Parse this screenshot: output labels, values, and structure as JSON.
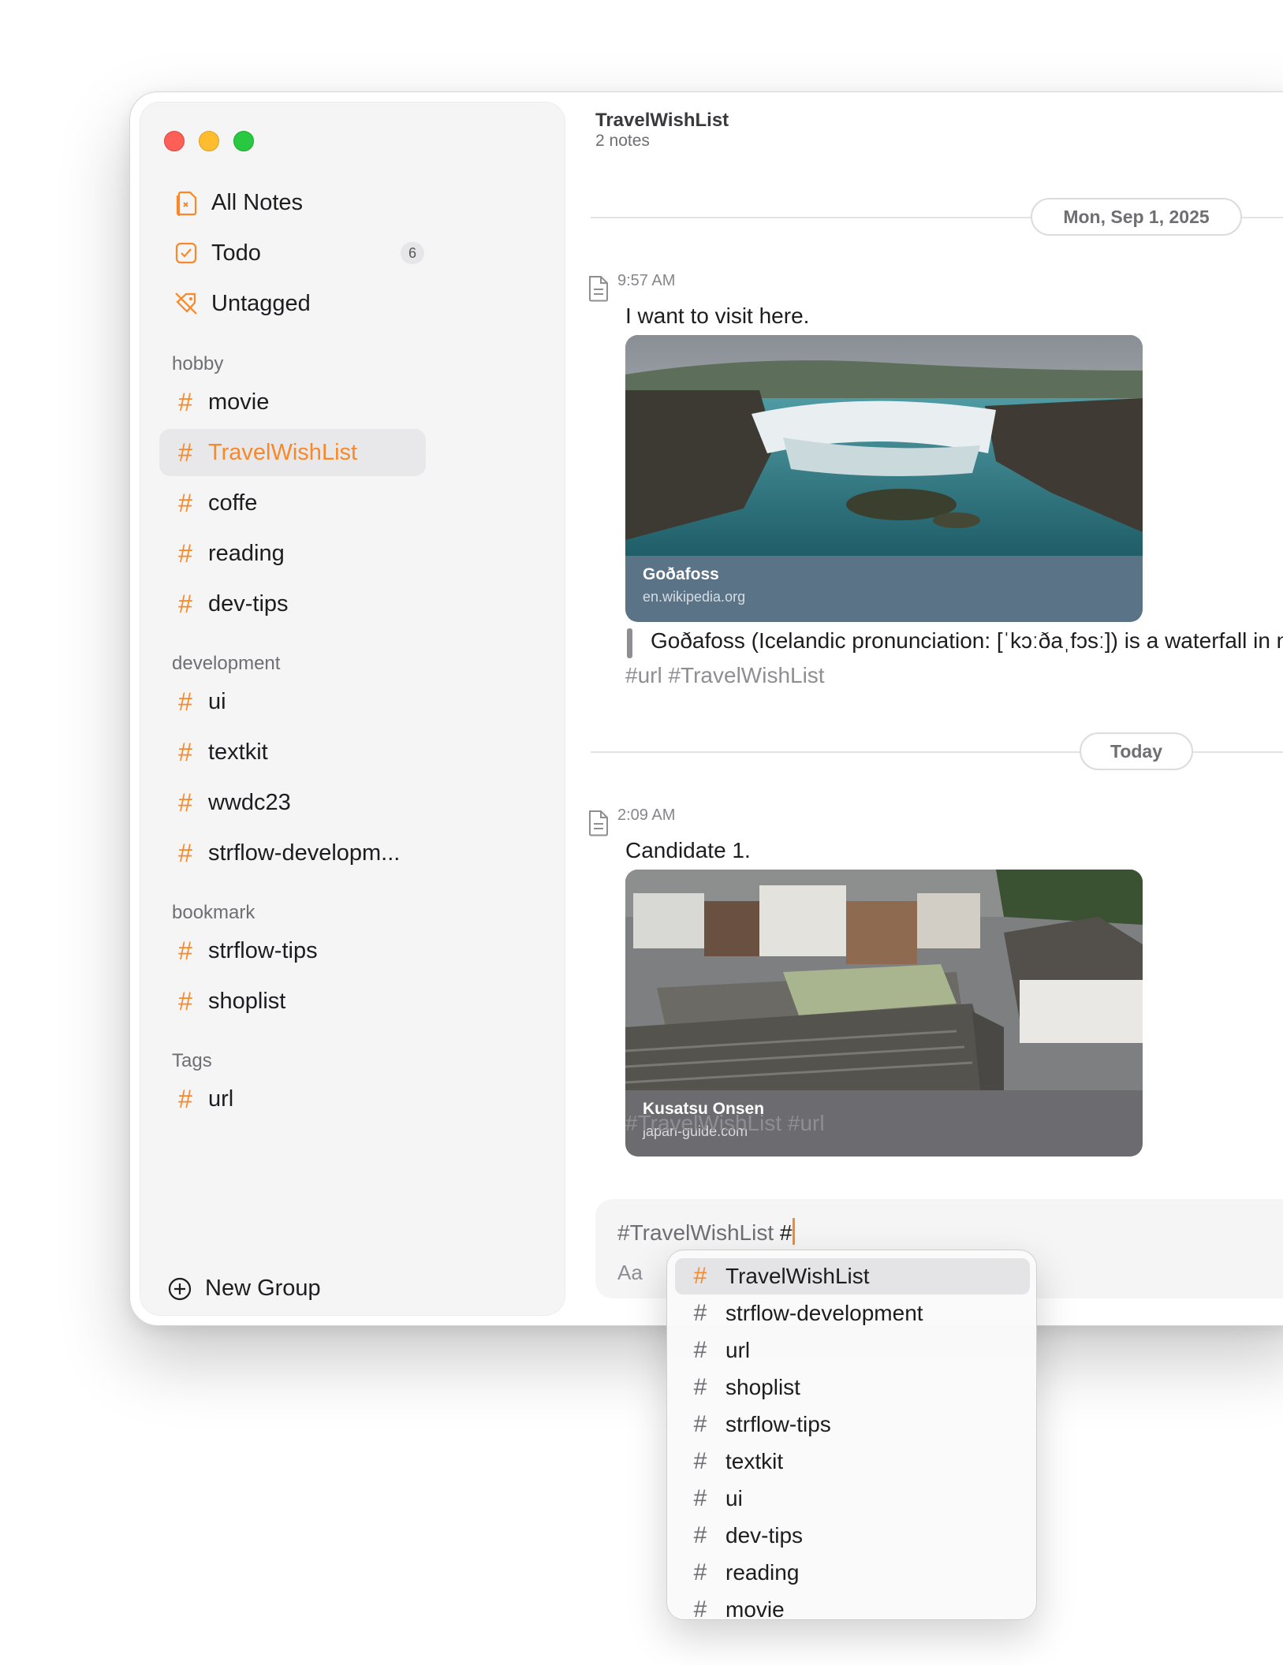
{
  "sidebar": {
    "nav": [
      {
        "label": "All Notes",
        "icon": "all-notes-icon"
      },
      {
        "label": "Todo",
        "icon": "todo-checkbox-icon",
        "badge": "6"
      },
      {
        "label": "Untagged",
        "icon": "untagged-icon"
      }
    ],
    "groups": [
      {
        "title": "hobby",
        "tags": [
          "movie",
          "TravelWishList",
          "coffe",
          "reading",
          "dev-tips"
        ]
      },
      {
        "title": "development",
        "tags": [
          "ui",
          "textkit",
          "wwdc23",
          "strflow-developm..."
        ]
      },
      {
        "title": "bookmark",
        "tags": [
          "strflow-tips",
          "shoplist"
        ]
      },
      {
        "title": "Tags",
        "tags": [
          "url"
        ]
      }
    ],
    "selected_tag": "TravelWishList",
    "new_group_label": "New Group"
  },
  "main": {
    "title": "TravelWishList",
    "subtitle": "2 notes",
    "dates": [
      "Mon, Sep 1, 2025",
      "Today"
    ],
    "notes": [
      {
        "time": "9:57 AM",
        "text": "I want to visit here.",
        "link": {
          "title": "Goðafoss",
          "site": "en.wikipedia.org",
          "image": "waterfall-photo"
        },
        "quote": "Goðafoss (Icelandic pronunciation: [ˈkɔːðaˌfɔsː]) is a waterfall in northern Ice",
        "tags": "#url #TravelWishList"
      },
      {
        "time": "2:09 AM",
        "text": "Candidate 1.",
        "link": {
          "title": "Kusatsu Onsen",
          "site": "japan-guide.com",
          "image": "hot-spring-town-photo"
        },
        "tags": "#TravelWishList #url"
      }
    ]
  },
  "composer": {
    "text": "#TravelWishList",
    "typing": "#",
    "format_label": "Aa",
    "image_button": "image-icon"
  },
  "autocomplete": {
    "items": [
      "TravelWishList",
      "strflow-development",
      "url",
      "shoplist",
      "strflow-tips",
      "textkit",
      "ui",
      "dev-tips",
      "reading",
      "movie"
    ],
    "active_index": 0
  },
  "colors": {
    "accent": "#f7892a",
    "link_card_1": "#5b7387",
    "link_card_2": "#6b6b70"
  }
}
